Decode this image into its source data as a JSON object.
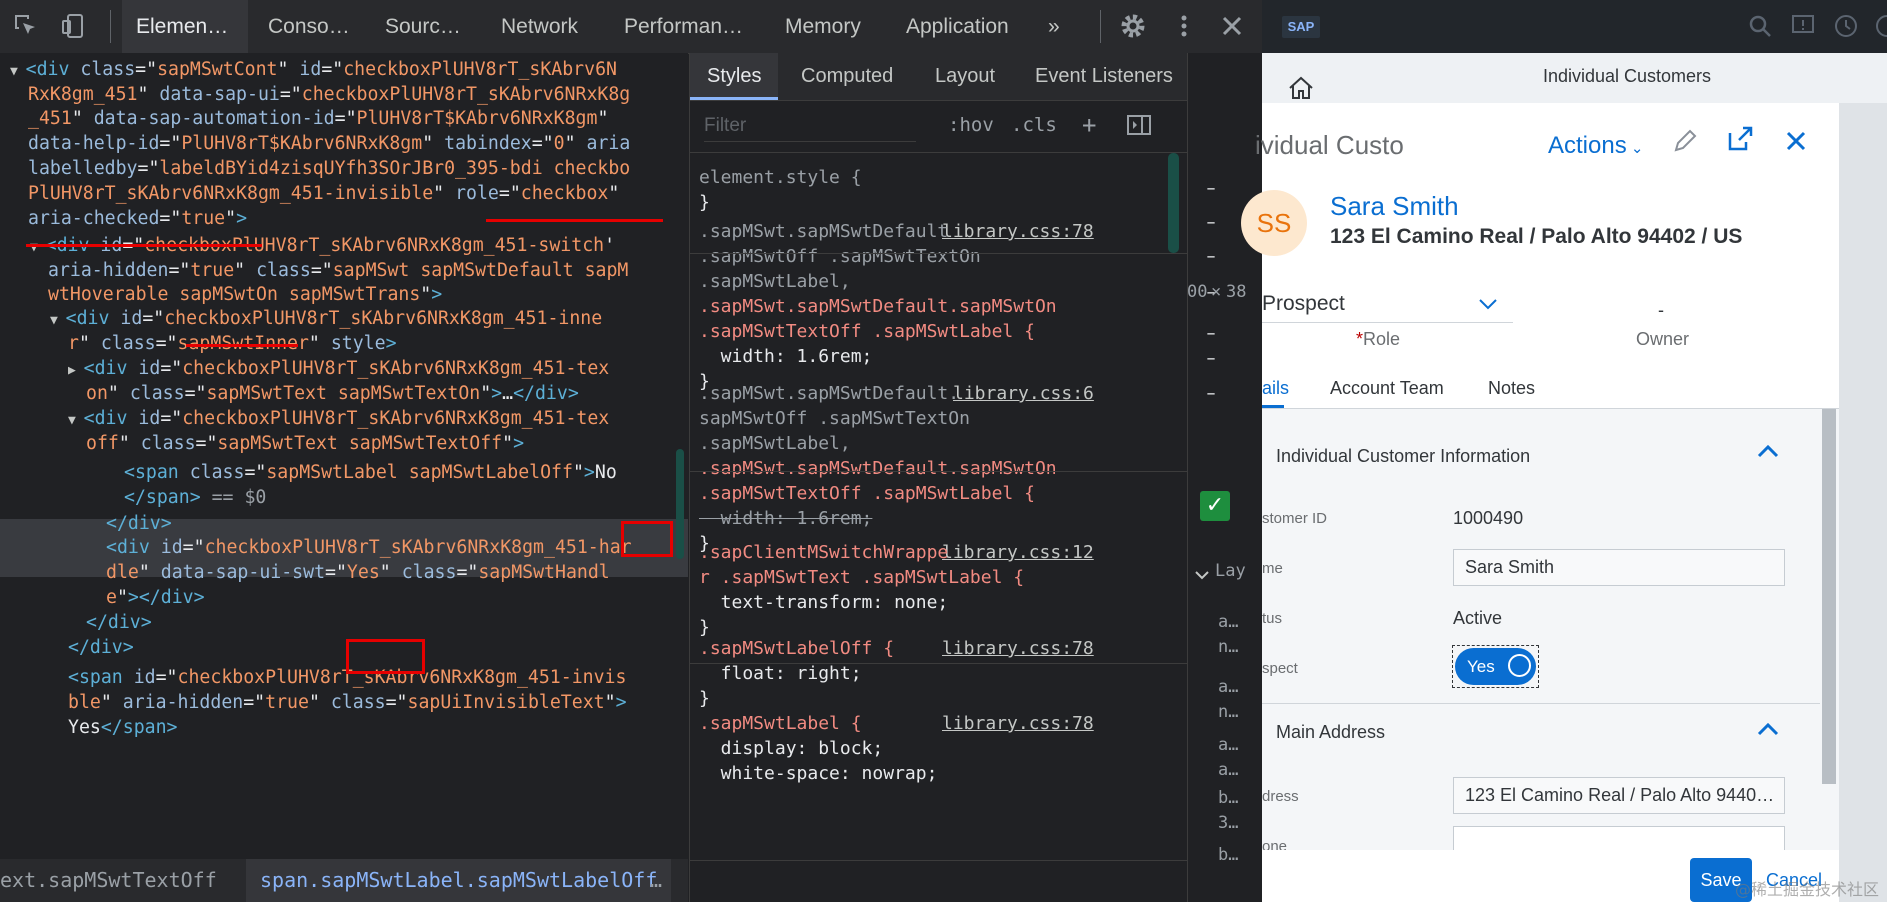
{
  "devtools": {
    "tabs": [
      "Elemen…",
      "Conso…",
      "Sourc…",
      "Network",
      "Performan…",
      "Memory",
      "Application"
    ],
    "more": "»",
    "elements_lines": [
      {
        "parts": [
          {
            "c": "tri",
            "t": "▼"
          },
          {
            "c": "tag",
            "t": "<div "
          },
          {
            "c": "an",
            "t": "class"
          },
          {
            "c": "txt",
            "t": "=\""
          },
          {
            "c": "av",
            "t": "sapMSwtCont"
          },
          {
            "c": "txt",
            "t": "\" "
          },
          {
            "c": "an",
            "t": "id"
          },
          {
            "c": "txt",
            "t": "=\""
          },
          {
            "c": "av",
            "t": "checkboxPlUHV8rT_sKAbrv6N"
          }
        ]
      },
      {
        "parts": [
          {
            "c": "av",
            "t": "RxK8gm_451"
          },
          {
            "c": "txt",
            "t": "\" "
          },
          {
            "c": "an",
            "t": "data-sap-ui"
          },
          {
            "c": "txt",
            "t": "=\""
          },
          {
            "c": "av",
            "t": "checkboxPlUHV8rT_sKAbrv6NRxK8g"
          }
        ]
      },
      {
        "parts": [
          {
            "c": "av",
            "t": "_451"
          },
          {
            "c": "txt",
            "t": "\" "
          },
          {
            "c": "an",
            "t": "data-sap-automation-id"
          },
          {
            "c": "txt",
            "t": "=\""
          },
          {
            "c": "av",
            "t": "PlUHV8rT$KAbrv6NRxK8gm"
          },
          {
            "c": "txt",
            "t": "\""
          }
        ]
      },
      {
        "parts": [
          {
            "c": "an",
            "t": "data-help-id"
          },
          {
            "c": "txt",
            "t": "=\""
          },
          {
            "c": "av",
            "t": "PlUHV8rT$KAbrv6NRxK8gm"
          },
          {
            "c": "txt",
            "t": "\" "
          },
          {
            "c": "an",
            "t": "tabindex"
          },
          {
            "c": "txt",
            "t": "=\""
          },
          {
            "c": "av",
            "t": "0"
          },
          {
            "c": "txt",
            "t": "\" "
          },
          {
            "c": "an",
            "t": "aria"
          }
        ]
      },
      {
        "parts": [
          {
            "c": "an",
            "t": "labelledby"
          },
          {
            "c": "txt",
            "t": "=\""
          },
          {
            "c": "av",
            "t": "labeldBYid4zisqUYfh3SOrJBr0_395-bdi checkbo"
          }
        ]
      },
      {
        "parts": [
          {
            "c": "av",
            "t": "PlUHV8rT_sKAbrv6NRxK8gm_451-invisible"
          },
          {
            "c": "txt",
            "t": "\" "
          },
          {
            "c": "an",
            "t": "role"
          },
          {
            "c": "txt",
            "t": "=\""
          },
          {
            "c": "av",
            "t": "checkbox"
          },
          {
            "c": "txt",
            "t": "\""
          }
        ]
      },
      {
        "parts": [
          {
            "c": "an",
            "t": "aria-checked"
          },
          {
            "c": "txt",
            "t": "=\""
          },
          {
            "c": "av",
            "t": "true"
          },
          {
            "c": "txt",
            "t": "\""
          },
          {
            "c": "tag",
            "t": ">"
          }
        ]
      },
      {
        "parts": [
          {
            "c": "tri",
            "t": "▼"
          },
          {
            "c": "tag",
            "t": "<div "
          },
          {
            "c": "an",
            "t": "id"
          },
          {
            "c": "txt",
            "t": "=\""
          },
          {
            "c": "av",
            "t": "checkboxPlUHV8rT_sKAbrv6NRxK8gm_451-switch"
          },
          {
            "c": "txt",
            "t": "'"
          }
        ]
      },
      {
        "parts": [
          {
            "c": "an",
            "t": "aria-hidden"
          },
          {
            "c": "txt",
            "t": "=\""
          },
          {
            "c": "av",
            "t": "true"
          },
          {
            "c": "txt",
            "t": "\" "
          },
          {
            "c": "an",
            "t": "class"
          },
          {
            "c": "txt",
            "t": "=\""
          },
          {
            "c": "av",
            "t": "sapMSwt sapMSwtDefault sapM"
          }
        ]
      },
      {
        "parts": [
          {
            "c": "av",
            "t": "wtHoverable sapMSwtOn sapMSwtTrans"
          },
          {
            "c": "txt",
            "t": "\""
          },
          {
            "c": "tag",
            "t": ">"
          }
        ]
      },
      {
        "parts": [
          {
            "c": "tri",
            "t": "▼"
          },
          {
            "c": "tag",
            "t": "<div "
          },
          {
            "c": "an",
            "t": "id"
          },
          {
            "c": "txt",
            "t": "=\""
          },
          {
            "c": "av",
            "t": "checkboxPlUHV8rT_sKAbrv6NRxK8gm_451-inne"
          }
        ]
      },
      {
        "parts": [
          {
            "c": "av",
            "t": "r"
          },
          {
            "c": "txt",
            "t": "\" "
          },
          {
            "c": "an",
            "t": "class"
          },
          {
            "c": "txt",
            "t": "=\""
          },
          {
            "c": "av",
            "t": "sapMSwtInner"
          },
          {
            "c": "txt",
            "t": "\" "
          },
          {
            "c": "an",
            "t": "style"
          },
          {
            "c": "tag",
            "t": ">"
          }
        ]
      },
      {
        "parts": [
          {
            "c": "tri",
            "t": "▶"
          },
          {
            "c": "tag",
            "t": "<div "
          },
          {
            "c": "an",
            "t": "id"
          },
          {
            "c": "txt",
            "t": "=\""
          },
          {
            "c": "av",
            "t": "checkboxPlUHV8rT_sKAbrv6NRxK8gm_451-tex"
          }
        ]
      },
      {
        "parts": [
          {
            "c": "av",
            "t": "on"
          },
          {
            "c": "txt",
            "t": "\" "
          },
          {
            "c": "an",
            "t": "class"
          },
          {
            "c": "txt",
            "t": "=\""
          },
          {
            "c": "av",
            "t": "sapMSwtText sapMSwtTextOn"
          },
          {
            "c": "txt",
            "t": "\""
          },
          {
            "c": "tag",
            "t": ">"
          },
          {
            "c": "txt",
            "t": "…"
          },
          {
            "c": "tag",
            "t": "</div>"
          }
        ]
      },
      {
        "parts": [
          {
            "c": "tri",
            "t": "▼"
          },
          {
            "c": "tag",
            "t": "<div "
          },
          {
            "c": "an",
            "t": "id"
          },
          {
            "c": "txt",
            "t": "=\""
          },
          {
            "c": "av",
            "t": "checkboxPlUHV8rT_sKAbrv6NRxK8gm_451-tex"
          }
        ]
      },
      {
        "parts": [
          {
            "c": "av",
            "t": "off"
          },
          {
            "c": "txt",
            "t": "\" "
          },
          {
            "c": "an",
            "t": "class"
          },
          {
            "c": "txt",
            "t": "=\""
          },
          {
            "c": "av",
            "t": "sapMSwtText sapMSwtTextOff"
          },
          {
            "c": "txt",
            "t": "\""
          },
          {
            "c": "tag",
            "t": ">"
          }
        ]
      },
      {
        "parts": [
          {
            "c": "tag",
            "t": "<span "
          },
          {
            "c": "an",
            "t": "class"
          },
          {
            "c": "txt",
            "t": "=\""
          },
          {
            "c": "av",
            "t": "sapMSwtLabel sapMSwtLabelOff"
          },
          {
            "c": "txt",
            "t": "\""
          },
          {
            "c": "tag",
            "t": ">"
          },
          {
            "c": "txt",
            "t": "No"
          }
        ]
      },
      {
        "parts": [
          {
            "c": "tag",
            "t": "</span>"
          },
          {
            "c": "sel-off",
            "t": " == $0"
          }
        ]
      },
      {
        "parts": [
          {
            "c": "tag",
            "t": "</div>"
          }
        ]
      },
      {
        "parts": [
          {
            "c": "tag",
            "t": "<div "
          },
          {
            "c": "an",
            "t": "id"
          },
          {
            "c": "txt",
            "t": "=\""
          },
          {
            "c": "av",
            "t": "checkboxPlUHV8rT_sKAbrv6NRxK8gm_451-har"
          }
        ]
      },
      {
        "parts": [
          {
            "c": "av",
            "t": "dle"
          },
          {
            "c": "txt",
            "t": "\" "
          },
          {
            "c": "an",
            "t": "data-sap-ui-swt"
          },
          {
            "c": "txt",
            "t": "=\""
          },
          {
            "c": "av",
            "t": "Yes"
          },
          {
            "c": "txt",
            "t": "\" "
          },
          {
            "c": "an",
            "t": "class"
          },
          {
            "c": "txt",
            "t": "=\""
          },
          {
            "c": "av",
            "t": "sapMSwtHandl"
          }
        ]
      },
      {
        "parts": [
          {
            "c": "av",
            "t": "e"
          },
          {
            "c": "txt",
            "t": "\""
          },
          {
            "c": "tag",
            "t": "></div>"
          }
        ]
      },
      {
        "parts": [
          {
            "c": "tag",
            "t": "</div>"
          }
        ]
      },
      {
        "parts": [
          {
            "c": "tag",
            "t": "</div>"
          }
        ]
      },
      {
        "parts": [
          {
            "c": "tag",
            "t": "<span "
          },
          {
            "c": "an",
            "t": "id"
          },
          {
            "c": "txt",
            "t": "=\""
          },
          {
            "c": "av",
            "t": "checkboxPlUHV8rT_sKAbrv6NRxK8gm_451-invis"
          }
        ]
      },
      {
        "parts": [
          {
            "c": "av",
            "t": "ble"
          },
          {
            "c": "txt",
            "t": "\" "
          },
          {
            "c": "an",
            "t": "aria-hidden"
          },
          {
            "c": "txt",
            "t": "=\""
          },
          {
            "c": "av",
            "t": "true"
          },
          {
            "c": "txt",
            "t": "\" "
          },
          {
            "c": "an",
            "t": "class"
          },
          {
            "c": "txt",
            "t": "=\""
          },
          {
            "c": "av",
            "t": "sapUiInvisibleText"
          },
          {
            "c": "txt",
            "t": "\""
          },
          {
            "c": "tag",
            "t": ">"
          }
        ]
      },
      {
        "parts": [
          {
            "c": "txt",
            "t": "Yes"
          },
          {
            "c": "tag",
            "t": "</span>"
          }
        ]
      }
    ],
    "breadcrumbs": {
      "prev": "ext.sapMSwtTextOff",
      "current": "span.sapMSwtLabel.sapMSwtLabelOff",
      "more": "…"
    },
    "styles_tabs": [
      "Styles",
      "Computed",
      "Layout",
      "Event Listeners"
    ],
    "styles_more": "»",
    "filter_placeholder": "Filter",
    "filter_hov": ":hov",
    "filter_cls": ".cls",
    "filter_add": "+",
    "rules": [
      {
        "lines": [
          {
            "c": "sel-off",
            "t": "element.style {"
          }
        ],
        "end": "}"
      },
      {
        "source": "library.css:78",
        "lines": [
          {
            "c": "sel-off",
            "t": ".sapMSwt.sapMSwtDefault"
          },
          {
            "c": "sel-off",
            "t": ".sapMSwtOff .sapMSwtTextOn"
          },
          {
            "c": "sel-off",
            "t": ".sapMSwtLabel,"
          },
          {
            "c": "sel-on",
            "t": ".sapMSwt.sapMSwtDefault.sapMSwtOn"
          },
          {
            "c": "sel-on",
            "t": ".sapMSwtTextOff .sapMSwtLabel {"
          },
          {
            "c": "prop",
            "t": "  width: 1.6rem;"
          }
        ],
        "end": "}"
      },
      {
        "source": "library.css:6",
        "lines": [
          {
            "c": "sel-off",
            "t": ".sapMSwt.sapMSwtDefault."
          },
          {
            "c": "sel-off",
            "t": "sapMSwtOff .sapMSwtTextOn"
          },
          {
            "c": "sel-off",
            "t": ".sapMSwtLabel,"
          },
          {
            "c": "sel-on",
            "t": ".sapMSwt.sapMSwtDefault.sapMSwtOn"
          },
          {
            "c": "sel-on",
            "t": ".sapMSwtTextOff .sapMSwtLabel {"
          },
          {
            "c": "strike",
            "t": "  width: 1.6rem;"
          }
        ],
        "end": "}"
      },
      {
        "source": "library.css:12",
        "lines": [
          {
            "c": "sel-on",
            "t": ".sapClientMSwitchWrappe"
          },
          {
            "c": "sel-on",
            "t": "r .sapMSwtText .sapMSwtLabel {"
          },
          {
            "c": "prop",
            "t": "  text-transform: none;"
          }
        ],
        "end": "}"
      },
      {
        "source": "library.css:78",
        "lines": [
          {
            "c": "sel-on",
            "t": ".sapMSwtLabelOff {"
          },
          {
            "c": "prop",
            "t": "  float: right;"
          }
        ],
        "end": "}"
      },
      {
        "source": "library.css:78",
        "lines": [
          {
            "c": "sel-on",
            "t": ".sapMSwtLabel {"
          },
          {
            "c": "prop",
            "t": "  display: block;"
          },
          {
            "c": "prop",
            "t": "  white-space: nowrap;"
          }
        ],
        "end": ""
      }
    ],
    "strip": {
      "dims_left": "00",
      "dims_x": "×",
      "dims_right": "38",
      "dashes": [
        "–",
        "–",
        "–",
        "–",
        "–",
        "–",
        "–"
      ],
      "layout_tab": "Lay",
      "frag_lines": [
        "a…",
        "n…",
        "a…",
        "n…",
        "a…",
        "a…",
        "b…",
        "3…",
        "b…"
      ]
    }
  },
  "app": {
    "window_title": "Individual Customers",
    "logo": "SAP",
    "header_name": "ividual Custo",
    "actions_label": "Actions",
    "avatar_initials": "SS",
    "customer_name": "Sara Smith",
    "customer_address": "123 El Camino Real / Palo Alto 94402 / US",
    "role_value": "Prospect",
    "role_label": "Role",
    "role_required": "*",
    "owner_value": "-",
    "owner_label": "Owner",
    "nav_tabs": [
      "ails",
      "Account Team",
      "Notes"
    ],
    "section1_title": "Individual Customer Information",
    "section2_title": "Main Address",
    "fields": [
      {
        "label": "stomer ID",
        "value": "1000490"
      },
      {
        "label": "me",
        "value": "Sara Smith"
      },
      {
        "label": "tus",
        "value": "Active"
      },
      {
        "label": "spect",
        "value": "Yes"
      }
    ],
    "address_label": "dress",
    "address_value": "123 El Camino Real / Palo Alto 9440…",
    "phone_label": "one",
    "phone_value": "",
    "save_label": "Save",
    "cancel_label": "Cancel",
    "watermark": "@稀土掘金技术社区"
  }
}
